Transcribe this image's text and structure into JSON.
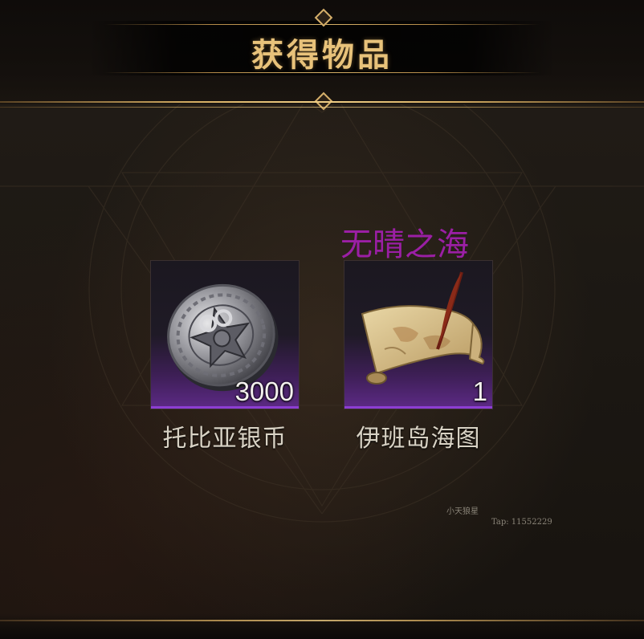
{
  "header": {
    "title": "获得物品"
  },
  "items": [
    {
      "name": "托比亚银币",
      "count": "3000",
      "icon": "silver-coin-icon",
      "rarity_color": "#5d2a86"
    },
    {
      "name": "伊班岛海图",
      "count": "1",
      "icon": "sea-chart-icon",
      "rarity_color": "#5d2a86"
    }
  ],
  "overlay": {
    "label": "无晴之海"
  },
  "watermark": {
    "line1": "小天狼星",
    "line2": "Tap: 11552229"
  },
  "colors": {
    "title": "#e8c27a",
    "frame_gold": "#d4ad63",
    "overlay_text": "#9b1fa5"
  }
}
